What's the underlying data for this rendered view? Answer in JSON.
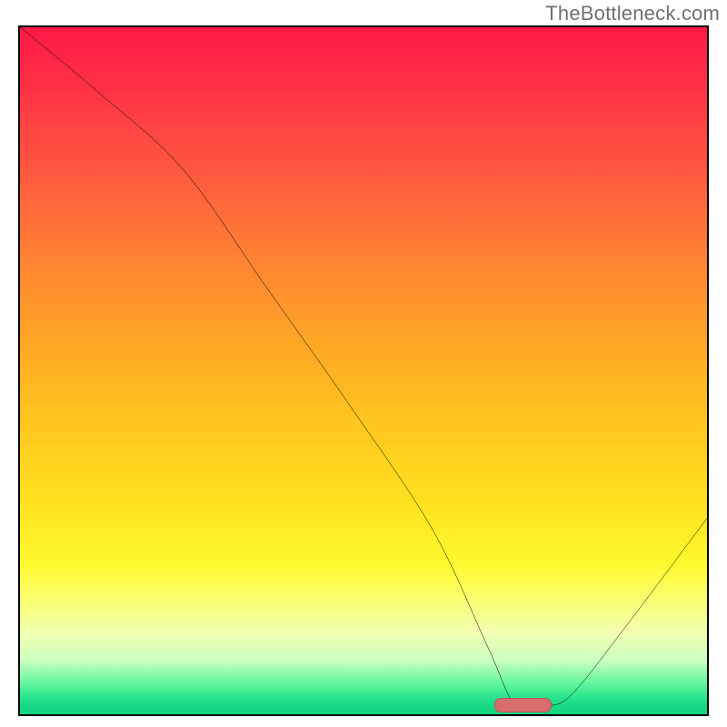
{
  "watermark": "TheBottleneck.com",
  "chart_data": {
    "type": "line",
    "title": "",
    "xlabel": "",
    "ylabel": "",
    "xlim": [
      0,
      100
    ],
    "ylim": [
      0,
      100
    ],
    "grid": false,
    "background": "red-yellow-green vertical gradient",
    "series": [
      {
        "name": "bottleneck-curve",
        "color": "#000000",
        "x": [
          0,
          12,
          24,
          36,
          48,
          60,
          68,
          72,
          76,
          80,
          88,
          100
        ],
        "y": [
          100,
          90,
          79,
          62,
          45,
          27,
          10,
          1.5,
          1.5,
          3,
          13,
          29
        ]
      }
    ],
    "marker": {
      "name": "optimal-range",
      "color": "#d86d6d",
      "x_start": 69,
      "x_end": 77,
      "y": 0.8
    },
    "gradient_stops": [
      {
        "pct": 0,
        "color": "#ff1846"
      },
      {
        "pct": 50,
        "color": "#ffc020"
      },
      {
        "pct": 80,
        "color": "#fff950"
      },
      {
        "pct": 100,
        "color": "#0ed280"
      }
    ]
  }
}
